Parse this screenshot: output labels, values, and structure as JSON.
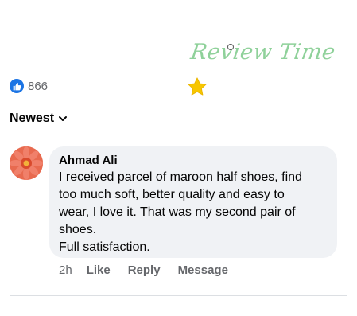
{
  "watermark": {
    "text": "Review Time"
  },
  "reactions": {
    "icon": "thumbs-up-icon",
    "count": "866",
    "badge_color": "#1b74e4"
  },
  "sort": {
    "label": "Newest",
    "icon": "chevron-down-icon"
  },
  "comment": {
    "author": "Ahmad Ali",
    "text_lines": [
      "I received parcel of maroon half shoes, find",
      "too much soft, better quality and easy to",
      "wear, I love it. That was my second pair of",
      "shoes.",
      "Full satisfaction."
    ],
    "bubble_color": "#f0f2f5"
  },
  "actions": {
    "time": "2h",
    "like": "Like",
    "reply": "Reply",
    "message": "Message"
  }
}
